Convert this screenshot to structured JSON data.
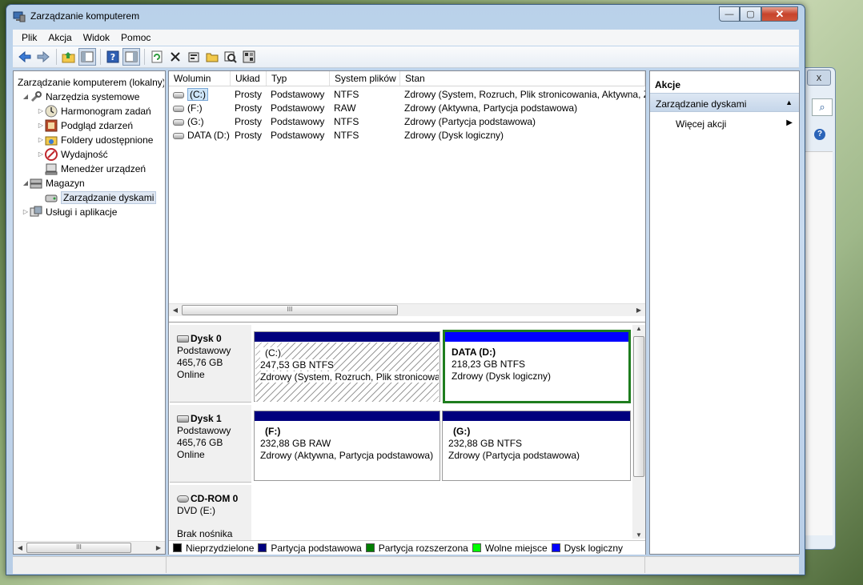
{
  "background_window": {
    "close_glyph": "x",
    "search_glyph": "⌕",
    "help_glyph": "?"
  },
  "window": {
    "title": "Zarządzanie komputerem",
    "controls": {
      "minimize": "—",
      "maximize": "▢",
      "close": "✕"
    }
  },
  "menu": [
    "Plik",
    "Akcja",
    "Widok",
    "Pomoc"
  ],
  "toolbar": {
    "icons": [
      "back-arrow-icon",
      "forward-arrow-icon",
      "up-folder-icon",
      "show-hide-console-tree-icon",
      "help-icon",
      "show-hide-action-pane-icon",
      "refresh-icon",
      "delete-icon",
      "properties-icon",
      "open-folder-icon",
      "rescan-disks-icon",
      "settings-icon"
    ]
  },
  "tree": {
    "root": "Zarządzanie komputerem (lokalny)",
    "items": [
      {
        "label": "Narzędzia systemowe",
        "level": 1,
        "expanded": true
      },
      {
        "label": "Harmonogram zadań",
        "level": 2
      },
      {
        "label": "Podgląd zdarzeń",
        "level": 2
      },
      {
        "label": "Foldery udostępnione",
        "level": 2
      },
      {
        "label": "Wydajność",
        "level": 2
      },
      {
        "label": "Menedżer urządzeń",
        "level": 2
      },
      {
        "label": "Magazyn",
        "level": 1,
        "expanded": true
      },
      {
        "label": "Zarządzanie dyskami",
        "level": 2,
        "selected": true
      },
      {
        "label": "Usługi i aplikacje",
        "level": 1
      }
    ]
  },
  "volumes": {
    "columns": [
      "Wolumin",
      "Układ",
      "Typ",
      "System plików",
      "Stan"
    ],
    "rows": [
      {
        "volume": "(C:)",
        "layout": "Prosty",
        "type": "Podstawowy",
        "fs": "NTFS",
        "status": "Zdrowy (System, Rozruch, Plik stronicowania, Aktywna, Z"
      },
      {
        "volume": "(F:)",
        "layout": "Prosty",
        "type": "Podstawowy",
        "fs": "RAW",
        "status": "Zdrowy (Aktywna, Partycja podstawowa)"
      },
      {
        "volume": "(G:)",
        "layout": "Prosty",
        "type": "Podstawowy",
        "fs": "NTFS",
        "status": "Zdrowy (Partycja podstawowa)"
      },
      {
        "volume": "DATA (D:)",
        "layout": "Prosty",
        "type": "Podstawowy",
        "fs": "NTFS",
        "status": "Zdrowy (Dysk logiczny)"
      }
    ],
    "hscroll_thumb": "III"
  },
  "disks": [
    {
      "name": "Dysk 0",
      "kind": "Podstawowy",
      "size": "465,76 GB",
      "state": "Online",
      "partitions": [
        {
          "label": "(C:)",
          "size": "247,53 GB NTFS",
          "status": "Zdrowy (System, Rozruch, Plik stronicowa"
        },
        {
          "label": "DATA  (D:)",
          "size": "218,23 GB NTFS",
          "status": "Zdrowy (Dysk logiczny)"
        }
      ]
    },
    {
      "name": "Dysk 1",
      "kind": "Podstawowy",
      "size": "465,76 GB",
      "state": "Online",
      "partitions": [
        {
          "label": "(F:)",
          "size": "232,88 GB RAW",
          "status": "Zdrowy (Aktywna, Partycja podstawowa)"
        },
        {
          "label": "(G:)",
          "size": "232,88 GB NTFS",
          "status": "Zdrowy (Partycja podstawowa)"
        }
      ]
    },
    {
      "name": "CD-ROM 0",
      "kind": "DVD (E:)",
      "state": "Brak nośnika"
    }
  ],
  "legend": [
    {
      "label": "Nieprzydzielone",
      "color": "#000000"
    },
    {
      "label": "Partycja podstawowa",
      "color": "#00007e"
    },
    {
      "label": "Partycja rozszerzona",
      "color": "#007e00"
    },
    {
      "label": "Wolne miejsce",
      "color": "#00ff00"
    },
    {
      "label": "Dysk logiczny",
      "color": "#0000ff"
    }
  ],
  "actions": {
    "title": "Akcje",
    "section": "Zarządzanie dyskami",
    "more": "Więcej akcji"
  },
  "left_hscroll_thumb": "III"
}
